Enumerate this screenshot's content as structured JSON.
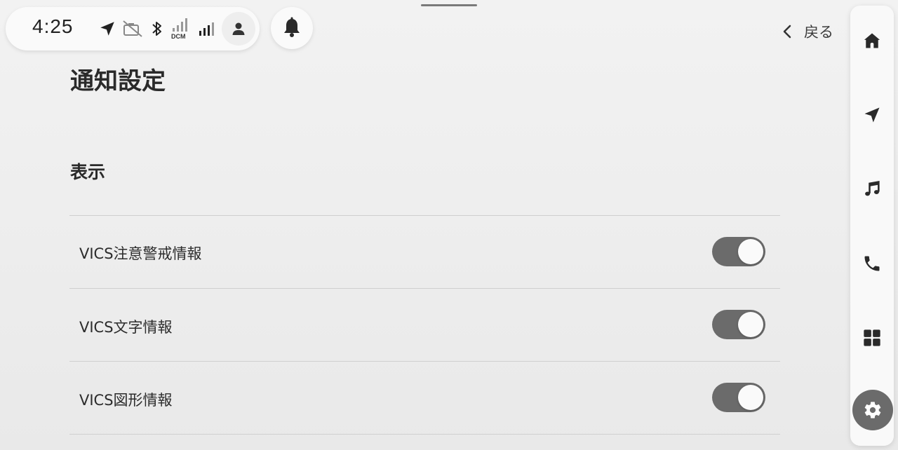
{
  "status_bar": {
    "time": "4:25",
    "icons": [
      "navigation-arrow-icon",
      "camera-off-icon",
      "bluetooth-icon",
      "dcm-signal-icon",
      "cellular-signal-icon",
      "user-icon"
    ],
    "dcm_label": "DCM"
  },
  "notifications": {
    "icon": "bell-icon"
  },
  "header": {
    "back_label": "戻る",
    "back_icon": "chevron-left-icon"
  },
  "page": {
    "title": "通知設定"
  },
  "section": {
    "title": "表示",
    "items": [
      {
        "label": "VICS注意警戒情報",
        "enabled": true
      },
      {
        "label": "VICS文字情報",
        "enabled": true
      },
      {
        "label": "VICS図形情報",
        "enabled": true
      }
    ]
  },
  "sidebar": {
    "items": [
      {
        "name": "home",
        "icon": "home-icon"
      },
      {
        "name": "navigation",
        "icon": "navigation-icon"
      },
      {
        "name": "music",
        "icon": "music-note-icon"
      },
      {
        "name": "phone",
        "icon": "phone-icon"
      },
      {
        "name": "apps",
        "icon": "grid-icon"
      },
      {
        "name": "settings",
        "icon": "gear-icon",
        "active": true
      }
    ]
  },
  "colors": {
    "toggle_on": "#6b6b6b",
    "active_nav": "#6b6b6b",
    "background": "#eeeeee"
  }
}
